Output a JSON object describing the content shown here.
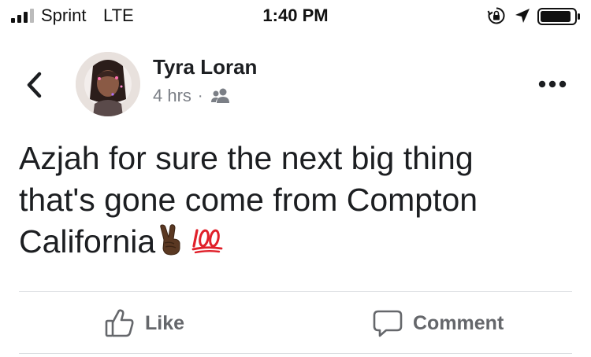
{
  "status_bar": {
    "carrier": "Sprint",
    "network": "LTE",
    "time": "1:40 PM"
  },
  "post": {
    "author": "Tyra Loran",
    "time": "4 hrs",
    "separator": "·",
    "audience_icon": "friends-icon",
    "text_lines": [
      "Azjah for sure the next big thing",
      "that's gone come from Compton",
      "California"
    ],
    "emojis": [
      "peace-sign-emoji",
      "hundred-points-emoji"
    ]
  },
  "actions": {
    "like_label": "Like",
    "comment_label": "Comment"
  },
  "colors": {
    "text": "#1c1e21",
    "secondary_text": "#7b7f86",
    "action_text": "#65676b",
    "divider": "#dadde1",
    "emoji_red": "#e0202a",
    "skin_tone": "#5a3822"
  }
}
